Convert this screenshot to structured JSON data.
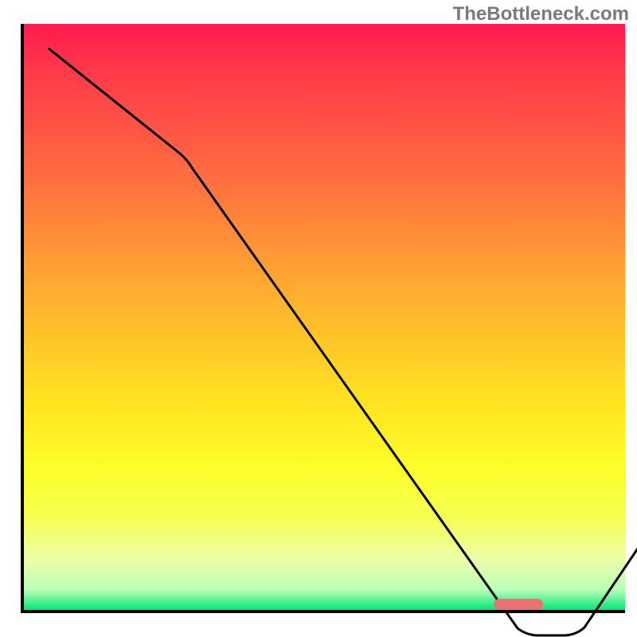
{
  "watermark": "TheBottleneck.com",
  "chart_data": {
    "type": "line",
    "title": "",
    "xlabel": "",
    "ylabel": "",
    "xlim": [
      0,
      100
    ],
    "ylim": [
      0,
      100
    ],
    "series": [
      {
        "name": "bottleneck-curve",
        "x": [
          0,
          22,
          79,
          81,
          86,
          100
        ],
        "values": [
          100,
          82,
          1,
          0,
          0,
          18
        ]
      }
    ],
    "marker": {
      "x_start": 78,
      "x_end": 86,
      "y": 0.8
    },
    "gradient_stops": [
      {
        "pos": 0,
        "color": "#ff1a4d"
      },
      {
        "pos": 50,
        "color": "#ffb830"
      },
      {
        "pos": 80,
        "color": "#fcff2a"
      },
      {
        "pos": 100,
        "color": "#00e676"
      }
    ]
  }
}
